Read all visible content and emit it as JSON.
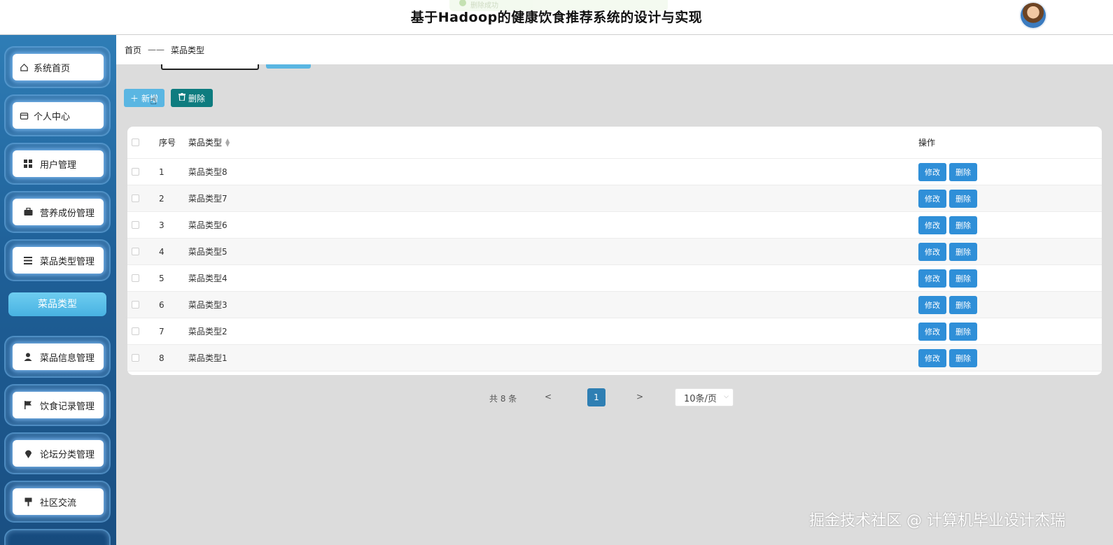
{
  "header": {
    "title": "基于Hadoop的健康饮食推荐系统的设计与实现",
    "toast": "删除成功"
  },
  "sidebar": {
    "items": [
      {
        "label": "系统首页",
        "icon": "home-icon"
      },
      {
        "label": "个人中心",
        "icon": "wallet-icon"
      },
      {
        "label": "用户管理",
        "icon": "grid-icon"
      },
      {
        "label": "营养成份管理",
        "icon": "briefcase-icon"
      },
      {
        "label": "菜品类型管理",
        "icon": "list-icon"
      },
      {
        "label": "菜品信息管理",
        "icon": "user-icon"
      },
      {
        "label": "饮食记录管理",
        "icon": "flag-icon"
      },
      {
        "label": "论坛分类管理",
        "icon": "location-pin-icon"
      },
      {
        "label": "社区交流",
        "icon": "sign-icon"
      }
    ],
    "submenu_active": "菜品类型"
  },
  "breadcrumb": {
    "home": "首页",
    "separator": "——",
    "current": "菜品类型"
  },
  "toolbar": {
    "add_label": "新增",
    "delete_label": "删除"
  },
  "table": {
    "headers": {
      "index": "序号",
      "name": "菜品类型",
      "ops": "操作"
    },
    "edit_label": "修改",
    "delete_label": "删除",
    "rows": [
      {
        "index": "1",
        "name": "菜品类型8"
      },
      {
        "index": "2",
        "name": "菜品类型7"
      },
      {
        "index": "3",
        "name": "菜品类型6"
      },
      {
        "index": "4",
        "name": "菜品类型5"
      },
      {
        "index": "5",
        "name": "菜品类型4"
      },
      {
        "index": "6",
        "name": "菜品类型3"
      },
      {
        "index": "7",
        "name": "菜品类型2"
      },
      {
        "index": "8",
        "name": "菜品类型1"
      }
    ]
  },
  "pagination": {
    "total": "共 8 条",
    "prev": "<",
    "current": "1",
    "next": ">",
    "page_size": "10条/页"
  },
  "watermark": "掘金技术社区 @ 计算机毕业设计杰瑞",
  "colors": {
    "sidebar": "#1e5f97",
    "primary": "#2f8fd8",
    "add": "#5ab6e2",
    "delete": "#0e7c7f",
    "active_page": "#2f7fb3"
  }
}
